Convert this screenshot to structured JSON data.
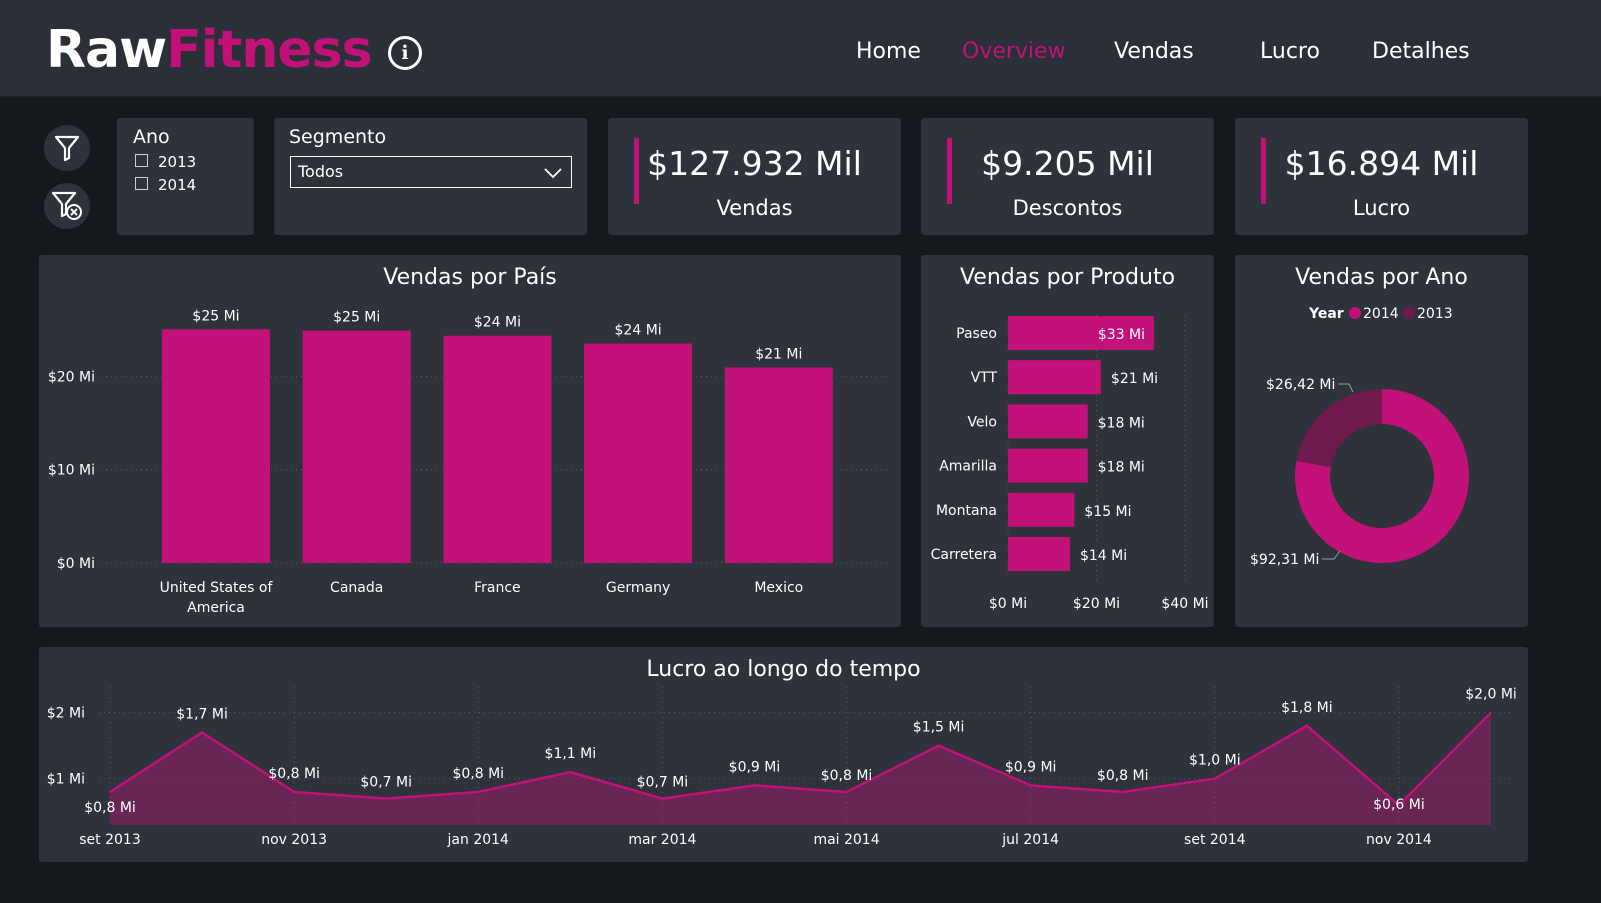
{
  "header": {
    "logo_part1": "Raw",
    "logo_part2": "Fitness",
    "info_icon": "info-icon",
    "nav": [
      {
        "label": "Home",
        "active": false
      },
      {
        "label": "Overview",
        "active": true
      },
      {
        "label": "Vendas",
        "active": false
      },
      {
        "label": "Lucro",
        "active": false
      },
      {
        "label": "Detalhes",
        "active": false
      }
    ]
  },
  "filters": {
    "filter_icon": "filter-icon",
    "clear_filter_icon": "clear-filter-icon",
    "ano": {
      "title": "Ano",
      "options": [
        {
          "label": "2013",
          "checked": false
        },
        {
          "label": "2014",
          "checked": false
        }
      ]
    },
    "segmento": {
      "title": "Segmento",
      "selected": "Todos"
    }
  },
  "kpis": [
    {
      "value": "$127.932 Mil",
      "label": "Vendas"
    },
    {
      "value": "$9.205 Mil",
      "label": "Descontos"
    },
    {
      "value": "$16.894 Mil",
      "label": "Lucro"
    }
  ],
  "colors": {
    "accent": "#c2127a",
    "accent_dark": "#6e1a4c",
    "card": "#2d323b",
    "header": "#2a2f38",
    "background": "#15181d",
    "grid": "#555b66"
  },
  "chart_data": [
    {
      "id": "vendas_por_pais",
      "type": "bar",
      "title": "Vendas por País",
      "categories": [
        "United States of America",
        "Canada",
        "France",
        "Germany",
        "Mexico"
      ],
      "values": [
        25.03,
        24.89,
        24.35,
        23.51,
        20.95
      ],
      "value_labels": [
        "$25 Mi",
        "$25 Mi",
        "$24 Mi",
        "$24 Mi",
        "$21 Mi"
      ],
      "y_ticks": [
        0,
        10,
        20
      ],
      "y_tick_labels": [
        "$0 Mi",
        "$10 Mi",
        "$20 Mi"
      ],
      "ylim": [
        0,
        27
      ],
      "grid": true
    },
    {
      "id": "vendas_por_produto",
      "type": "bar",
      "orientation": "horizontal",
      "title": "Vendas por Produto",
      "categories": [
        "Paseo",
        "VTT",
        "Velo",
        "Amarilla",
        "Montana",
        "Carretera"
      ],
      "values": [
        33,
        21,
        18,
        18,
        15,
        14
      ],
      "value_labels": [
        "$33 Mi",
        "$21 Mi",
        "$18 Mi",
        "$18 Mi",
        "$15 Mi",
        "$14 Mi"
      ],
      "x_ticks": [
        0,
        20,
        40
      ],
      "x_tick_labels": [
        "$0 Mi",
        "$20 Mi",
        "$40 Mi"
      ],
      "xlim": [
        0,
        40
      ],
      "grid": true
    },
    {
      "id": "vendas_por_ano",
      "type": "pie",
      "title": "Vendas por Ano",
      "legend_title": "Year",
      "legend_position": "top",
      "series": [
        {
          "name": "2014",
          "value": 92.31,
          "label": "$92,31 Mi"
        },
        {
          "name": "2013",
          "value": 26.42,
          "label": "$26,42 Mi"
        }
      ]
    },
    {
      "id": "lucro_ao_longo_do_tempo",
      "type": "area",
      "title": "Lucro ao longo do tempo",
      "x": [
        "2013-09",
        "2013-10",
        "2013-11",
        "2013-12",
        "2014-01",
        "2014-02",
        "2014-03",
        "2014-04",
        "2014-05",
        "2014-06",
        "2014-07",
        "2014-08",
        "2014-09",
        "2014-10",
        "2014-11",
        "2014-12"
      ],
      "values": [
        0.8,
        1.7,
        0.8,
        0.7,
        0.8,
        1.1,
        0.7,
        0.9,
        0.8,
        1.5,
        0.9,
        0.8,
        1.0,
        1.8,
        0.6,
        2.0
      ],
      "value_labels": [
        "$0,8 Mi",
        "$1,7 Mi",
        "$0,8 Mi",
        "$0,7 Mi",
        "$0,8 Mi",
        "$1,1 Mi",
        "$0,7 Mi",
        "$0,9 Mi",
        "$0,8 Mi",
        "$1,5 Mi",
        "$0,9 Mi",
        "$0,8 Mi",
        "$1,0 Mi",
        "$1,8 Mi",
        "$0,6 Mi",
        "$2,0 Mi"
      ],
      "x_tick_labels": [
        "set 2013",
        "nov 2013",
        "jan 2014",
        "mar 2014",
        "mai 2014",
        "jul 2014",
        "set 2014",
        "nov 2014"
      ],
      "y_ticks": [
        1,
        2
      ],
      "y_tick_labels": [
        "$1 Mi",
        "$2 Mi"
      ],
      "ylim": [
        0.3,
        2.1
      ],
      "grid": true
    }
  ]
}
